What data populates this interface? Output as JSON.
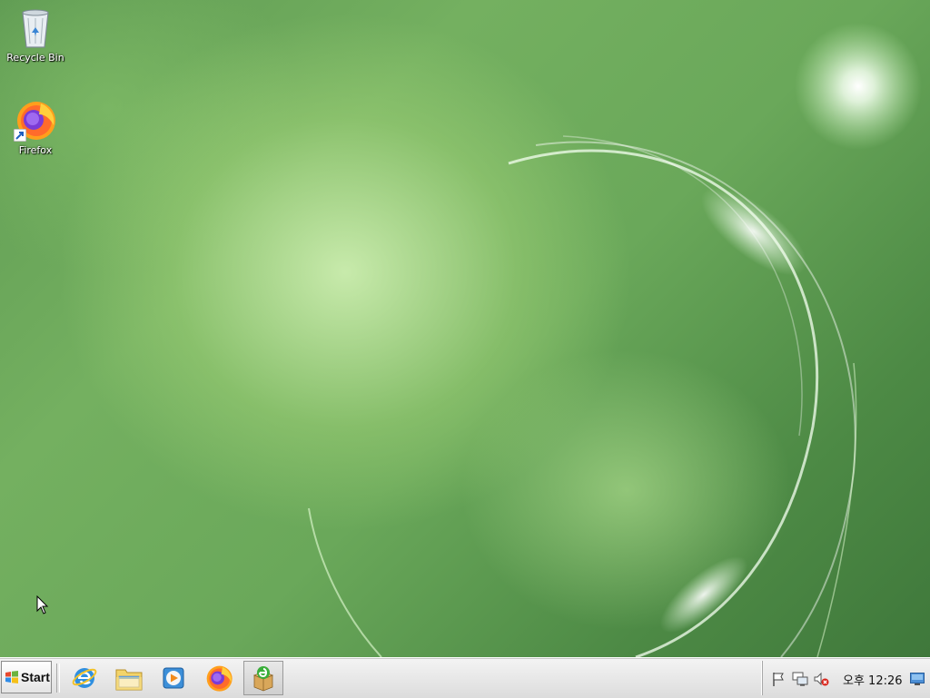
{
  "desktop": {
    "icons": [
      {
        "label": "Recycle Bin",
        "icon": "recycle-bin-icon"
      },
      {
        "label": "Firefox",
        "icon": "firefox-icon"
      }
    ],
    "wallpaper": "green aurora",
    "colors": {
      "wallpaper_base": "#6aa85a",
      "wallpaper_light": "#d7f5b9"
    }
  },
  "taskbar": {
    "start_label": "Start",
    "quick_launch": [
      {
        "name": "Internet Explorer",
        "icon": "internet-explorer-icon"
      },
      {
        "name": "Windows Explorer",
        "icon": "file-explorer-icon"
      },
      {
        "name": "Media Player",
        "icon": "media-player-icon"
      },
      {
        "name": "Firefox",
        "icon": "firefox-icon"
      },
      {
        "name": "Installer",
        "icon": "installer-package-icon",
        "active": true
      }
    ],
    "tray": {
      "icons": [
        "action-center-flag-icon",
        "network-icon",
        "volume-muted-icon",
        "show-desktop-icon"
      ],
      "clock": "오후 12:26"
    },
    "colors": {
      "background": "#e6e6e6",
      "border": "#a8a8a8"
    }
  }
}
